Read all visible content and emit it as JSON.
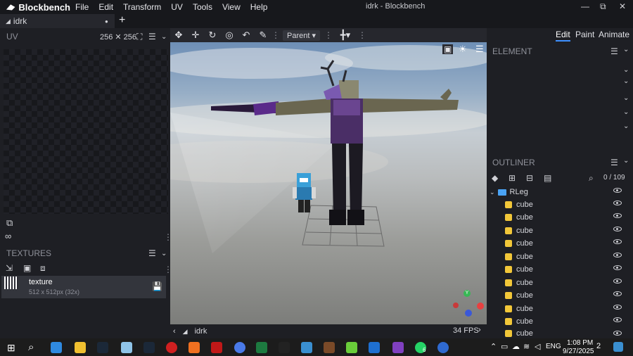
{
  "titlebar": {
    "app_name": "Blockbench",
    "menu": [
      "File",
      "Edit",
      "Transform",
      "UV",
      "Tools",
      "View",
      "Help"
    ],
    "window_title": "idrk - Blockbench",
    "minimize": "—",
    "maximize": "⧉",
    "close": "✕"
  },
  "tabs": [
    {
      "label": "idrk",
      "dot": "●"
    }
  ],
  "new_tab": "+",
  "uv_panel": {
    "title": "UV",
    "size": "256 ✕ 256"
  },
  "textures_panel": {
    "title": "TEXTURES",
    "texture": {
      "name": "texture",
      "info": "512 x 512px (32x)"
    }
  },
  "toolbar": {
    "pivot_mode": "Parent"
  },
  "viewport_footer": {
    "model_name": "idrk",
    "fps": "34 FPS"
  },
  "modes": [
    "Edit",
    "Paint",
    "Animate"
  ],
  "active_mode": "Edit",
  "element_panel": {
    "title": "ELEMENT"
  },
  "outliner": {
    "title": "OUTLINER",
    "count": "0 / 109",
    "group": "RLeg",
    "items": [
      "cube",
      "cube",
      "cube",
      "cube",
      "cube",
      "cube",
      "cube",
      "cube",
      "cube",
      "cube",
      "cube"
    ]
  },
  "gizmo": {
    "y": "Y"
  },
  "taskbar": {
    "time": "1:08 PM",
    "date": "9/27/2025",
    "lang": "ENG",
    "notif": "2",
    "whatsapp_badge": "6"
  },
  "colors": {
    "accent": "#3e90ff",
    "cube": "#f2c739",
    "folder": "#4aa3f5"
  }
}
